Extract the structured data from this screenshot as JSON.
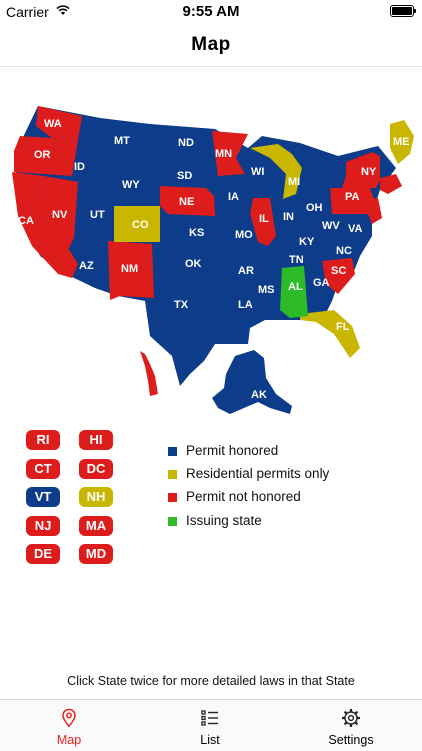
{
  "status_bar": {
    "carrier": "Carrier",
    "time": "9:55 AM"
  },
  "nav": {
    "title": "Map"
  },
  "colors": {
    "honored": "#0c3c8a",
    "residential": "#c8b600",
    "not_honored": "#dd1c1c",
    "issuing": "#2dbb2a"
  },
  "map": {
    "states": {
      "WA": "WA",
      "OR": "OR",
      "CA": "CA",
      "NV": "NV",
      "ID": "ID",
      "MT": "MT",
      "WY": "WY",
      "UT": "UT",
      "CO": "CO",
      "AZ": "AZ",
      "NM": "NM",
      "ND": "ND",
      "SD": "SD",
      "NE": "NE",
      "KS": "KS",
      "OK": "OK",
      "TX": "TX",
      "MN": "MN",
      "IA": "IA",
      "MO": "MO",
      "AR": "AR",
      "LA": "LA",
      "WI": "WI",
      "IL": "IL",
      "MI": "MI",
      "IN": "IN",
      "OH": "OH",
      "KY": "KY",
      "TN": "TN",
      "MS": "MS",
      "AL": "AL",
      "GA": "GA",
      "FL": "FL",
      "SC": "SC",
      "NC": "NC",
      "VA": "VA",
      "WV": "WV",
      "PA": "PA",
      "NY": "NY",
      "ME": "ME",
      "AK": "AK"
    }
  },
  "small_states": [
    {
      "code": "RI",
      "status": "not_honored"
    },
    {
      "code": "HI",
      "status": "not_honored"
    },
    {
      "code": "CT",
      "status": "not_honored"
    },
    {
      "code": "DC",
      "status": "not_honored"
    },
    {
      "code": "VT",
      "status": "honored"
    },
    {
      "code": "NH",
      "status": "residential"
    },
    {
      "code": "NJ",
      "status": "not_honored"
    },
    {
      "code": "MA",
      "status": "not_honored"
    },
    {
      "code": "DE",
      "status": "not_honored"
    },
    {
      "code": "MD",
      "status": "not_honored"
    }
  ],
  "legend": [
    {
      "label": "Permit honored",
      "status": "honored"
    },
    {
      "label": "Residential permits only",
      "status": "residential"
    },
    {
      "label": "Permit not honored",
      "status": "not_honored"
    },
    {
      "label": "Issuing state",
      "status": "issuing"
    }
  ],
  "hint": "Click State twice for more detailed laws in that State",
  "tabs": [
    {
      "label": "Map",
      "icon": "map-pin-icon",
      "active": true
    },
    {
      "label": "List",
      "icon": "list-icon",
      "active": false
    },
    {
      "label": "Settings",
      "icon": "gear-icon",
      "active": false
    }
  ]
}
